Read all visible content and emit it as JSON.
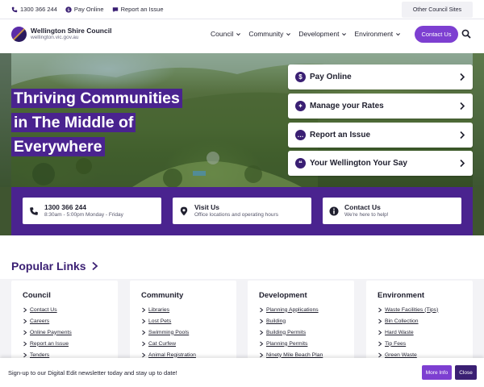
{
  "utility": {
    "phone": "1300 366 244",
    "pay_online": "Pay Online",
    "report_issue": "Report an Issue",
    "other_sites": "Other Council Sites"
  },
  "header": {
    "logo_name": "Wellington Shire Council",
    "logo_url": "wellington.vic.gov.au",
    "nav": [
      "Council",
      "Community",
      "Development",
      "Environment"
    ],
    "contact_us": "Contact Us"
  },
  "hero": {
    "title_lines": [
      "Thriving Communities",
      "in The Middle of",
      "Everywhere"
    ],
    "quick_links": [
      {
        "label": "Pay Online",
        "icon": "dollar-icon"
      },
      {
        "label": "Manage your Rates",
        "icon": "rates-icon"
      },
      {
        "label": "Report an Issue",
        "icon": "chat-icon"
      },
      {
        "label": "Your Wellington Your Say",
        "icon": "speech-bubbles-icon"
      }
    ]
  },
  "contact_band": [
    {
      "title": "1300 366 244",
      "subtitle": "8:30am - 5:00pm Monday - Friday",
      "icon": "phone-icon"
    },
    {
      "title": "Visit Us",
      "subtitle": "Office locations and operating hours",
      "icon": "map-pin-icon"
    },
    {
      "title": "Contact Us",
      "subtitle": "We're here to help!",
      "icon": "info-icon"
    }
  ],
  "popular_links": {
    "title": "Popular Links",
    "columns": [
      {
        "heading": "Council",
        "links": [
          "Contact Us",
          "Careers",
          "Online Payments",
          "Report an Issue",
          "Tenders"
        ]
      },
      {
        "heading": "Community",
        "links": [
          "Libraries",
          "Lost Pets",
          "Swimming Pools",
          "Cat Curfew",
          "Animal Registration"
        ]
      },
      {
        "heading": "Development",
        "links": [
          "Planning Applications",
          "Building",
          "Building Permits",
          "Planning Permits",
          "Ninety Mile Beach Plan"
        ]
      },
      {
        "heading": "Environment",
        "links": [
          "Waste Facilities (Tips)",
          "Bin Collection",
          "Hard Waste",
          "Tip Fees",
          "Green Waste"
        ]
      }
    ]
  },
  "newsletter": {
    "text": "Sign-up to our Digital Edit newsletter today and stay up to date!",
    "more_info": "More Info",
    "close": "Close"
  },
  "colors": {
    "brand_purple": "#4a238f",
    "accent_purple": "#7d3fd1",
    "dark_purple": "#3a1f73"
  }
}
